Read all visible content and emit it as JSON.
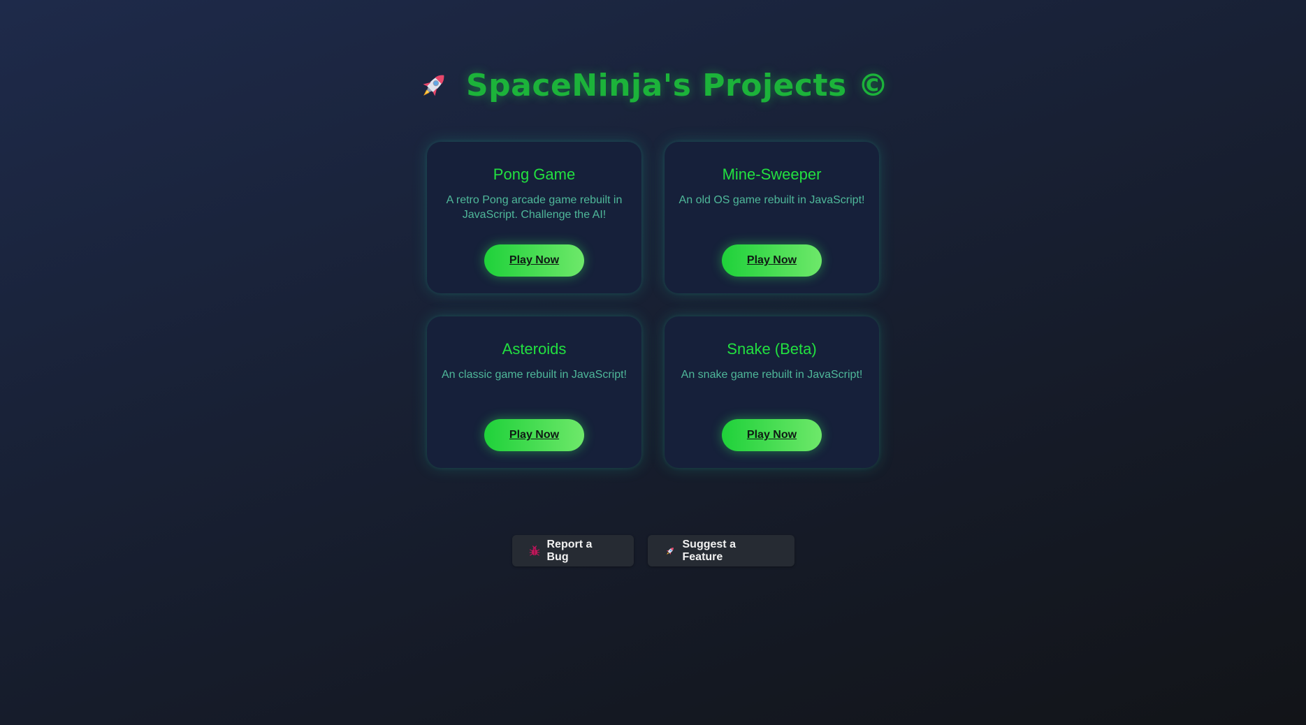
{
  "header": {
    "title": "SpaceNinja's Projects ©",
    "icon": "rocket-icon"
  },
  "projects": [
    {
      "title": "Pong Game",
      "description": "A retro Pong arcade game rebuilt in JavaScript. Challenge the AI!",
      "button_label": "Play Now"
    },
    {
      "title": "Mine-Sweeper",
      "description": "An old OS game rebuilt in JavaScript!",
      "button_label": "Play Now"
    },
    {
      "title": "Asteroids",
      "description": "An classic game rebuilt in JavaScript!",
      "button_label": "Play Now"
    },
    {
      "title": "Snake (Beta)",
      "description": "An snake game rebuilt in JavaScript!",
      "button_label": "Play Now"
    }
  ],
  "footer": {
    "bug_label": "Report a Bug",
    "bug_icon": "bug-icon",
    "feature_label": "Suggest a Feature",
    "feature_icon": "rocket-icon"
  },
  "colors": {
    "accent": "#1cb33a",
    "card_title": "#22e040",
    "card_text": "#4fb89a",
    "button_gradient_start": "#1fd13a",
    "button_gradient_end": "#6ee86a"
  }
}
